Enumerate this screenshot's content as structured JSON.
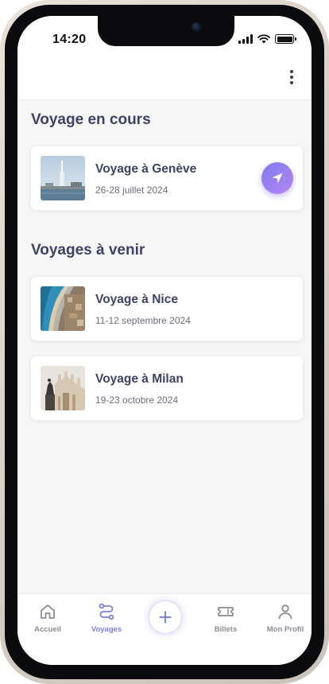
{
  "status_bar": {
    "time": "14:20"
  },
  "sections": {
    "current": {
      "title": "Voyage en cours"
    },
    "upcoming": {
      "title": "Voyages à venir"
    }
  },
  "trips": {
    "geneve": {
      "title": "Voyage à Genève",
      "dates": "26-28 juillet 2024"
    },
    "nice": {
      "title": "Voyage à Nice",
      "dates": "11-12 septembre 2024"
    },
    "milan": {
      "title": "Voyage à Milan",
      "dates": "19-23 octobre 2024"
    }
  },
  "tabs": {
    "home": {
      "label": "Accueil",
      "icon": "home-icon"
    },
    "trips": {
      "label": "Voyages",
      "icon": "route-icon",
      "active": true
    },
    "add": {
      "icon": "plus-icon"
    },
    "tickets": {
      "label": "Billets",
      "icon": "ticket-icon"
    },
    "profile": {
      "label": "Mon Profil",
      "icon": "user-icon"
    }
  },
  "colors": {
    "accent": "#7b7fe0",
    "title_text": "#3f4262",
    "secondary_text": "#6b6e7a",
    "background": "#f6f6f7"
  }
}
